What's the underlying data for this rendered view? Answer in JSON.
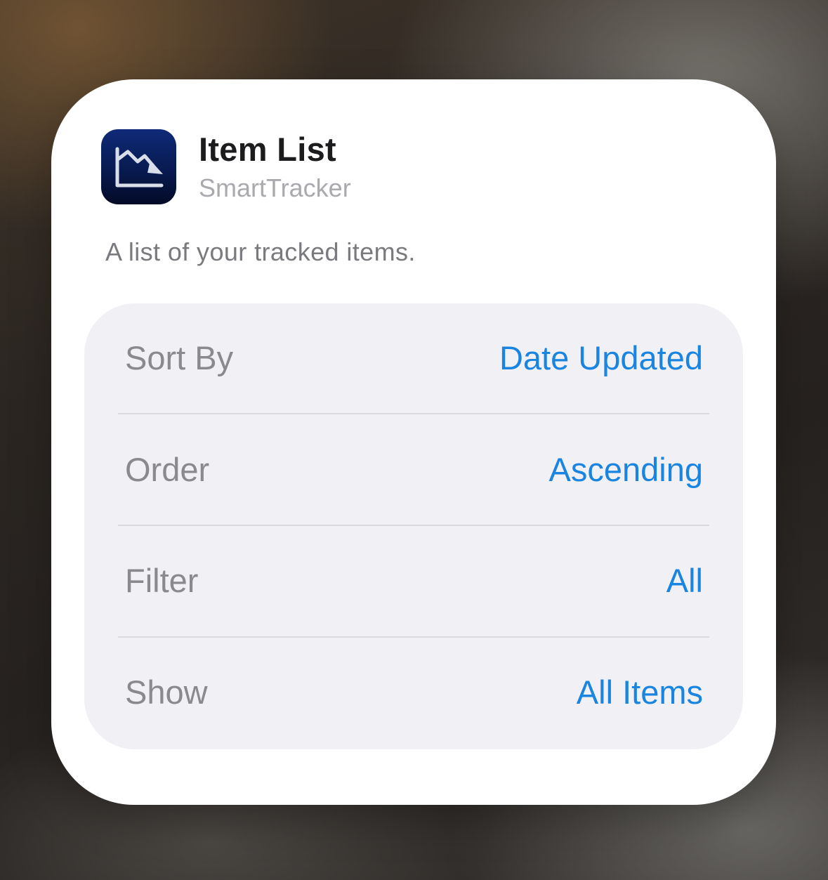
{
  "widget": {
    "title": "Item List",
    "app_name": "SmartTracker",
    "description": "A list of your tracked items.",
    "app_icon": "chart-down-trend-icon"
  },
  "settings": [
    {
      "label": "Sort By",
      "value": "Date Updated"
    },
    {
      "label": "Order",
      "value": "Ascending"
    },
    {
      "label": "Filter",
      "value": "All"
    },
    {
      "label": "Show",
      "value": "All Items"
    }
  ],
  "colors": {
    "accent": "#1a85e0",
    "icon_background": "#081a50",
    "group_background": "#f1f1f5"
  }
}
